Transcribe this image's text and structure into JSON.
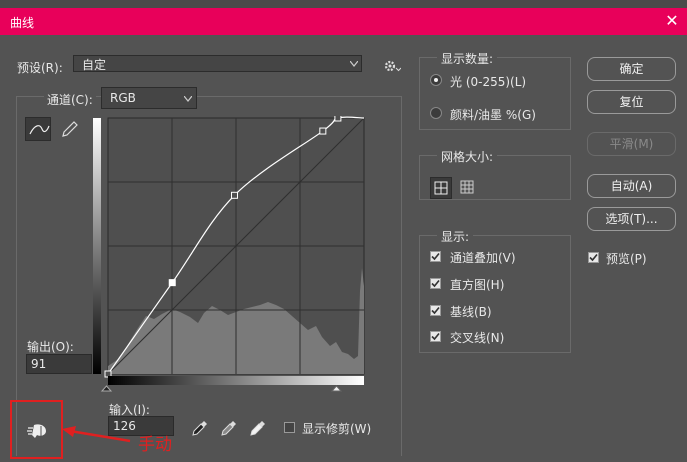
{
  "window": {
    "title": "曲线",
    "close_glyph": "✕"
  },
  "preset": {
    "label": "预设(R):",
    "value": "自定"
  },
  "channel": {
    "label": "通道(C):",
    "value": "RGB"
  },
  "output": {
    "label": "输出(O):",
    "value": "91"
  },
  "input": {
    "label": "输入(I):",
    "value": "126"
  },
  "clipping": {
    "label": "显示修剪(W)",
    "checked": false
  },
  "display_amount": {
    "title": "显示数量:",
    "options": [
      {
        "label": "光 (0-255)(L)",
        "selected": true
      },
      {
        "label": "颜料/油墨 %(G)",
        "selected": false
      }
    ]
  },
  "grid_size": {
    "title": "网格大小:"
  },
  "show": {
    "title": "显示:",
    "items": [
      {
        "label": "通道叠加(V)",
        "checked": true
      },
      {
        "label": "直方图(H)",
        "checked": true
      },
      {
        "label": "基线(B)",
        "checked": true
      },
      {
        "label": "交叉线(N)",
        "checked": true
      }
    ]
  },
  "buttons": {
    "ok": "确定",
    "reset": "复位",
    "smooth": "平滑(M)",
    "auto": "自动(A)",
    "options": "选项(T)..."
  },
  "preview": {
    "label": "预览(P)",
    "checked": true
  },
  "annotation": {
    "text": "手动",
    "color": "#e02020"
  },
  "curve": {
    "points": [
      [
        0,
        0
      ],
      [
        64,
        91
      ],
      [
        126,
        178
      ],
      [
        214,
        242
      ],
      [
        229,
        255
      ],
      [
        255,
        255
      ]
    ],
    "selected_point_index": 1
  },
  "colors": {
    "title_bar": "#e8005a",
    "panel": "#535353",
    "annotation": "#e02020"
  }
}
